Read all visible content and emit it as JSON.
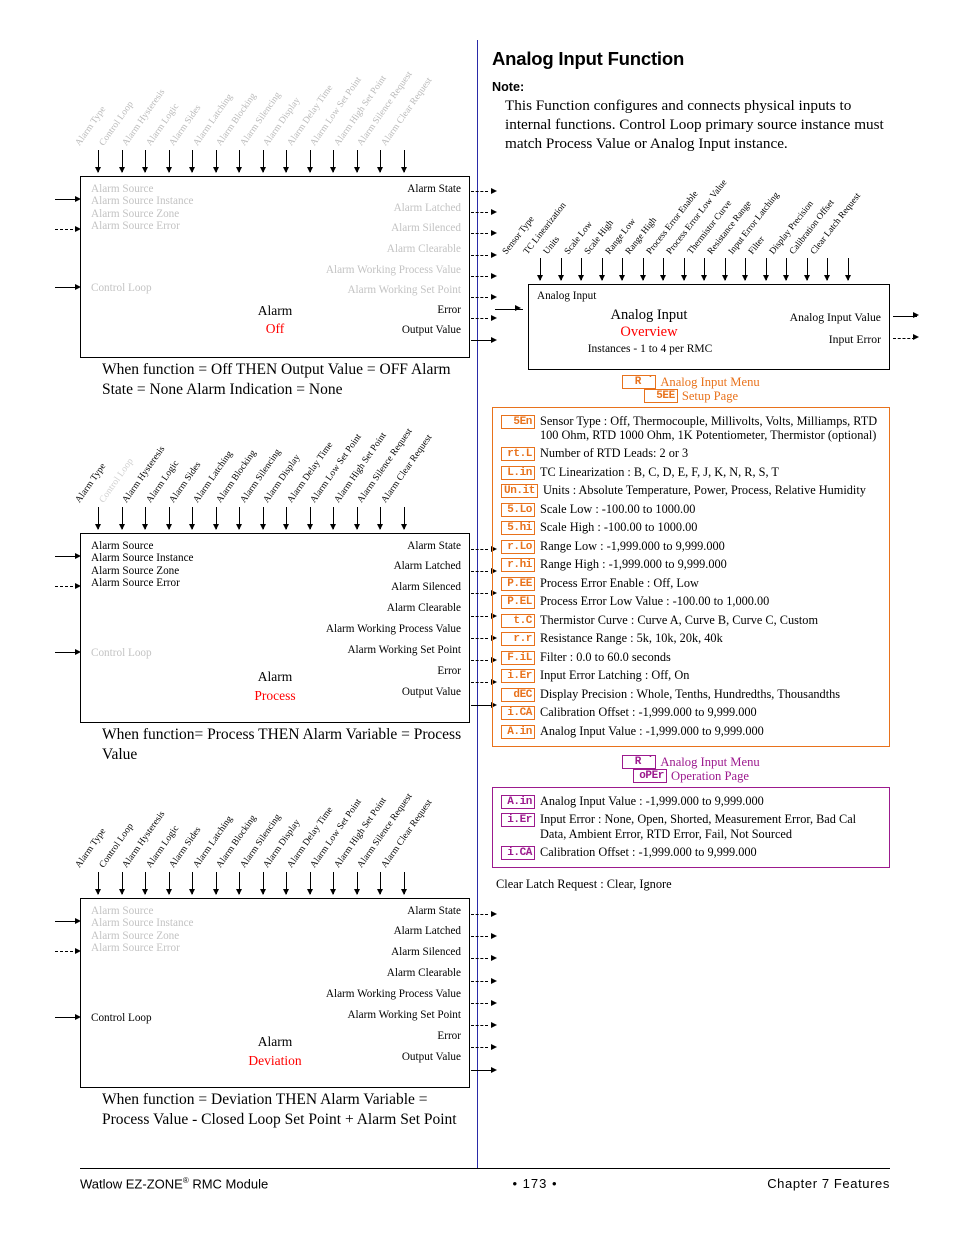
{
  "page": {
    "footer_left": "Watlow EZ-ZONE",
    "footer_left_sup": "®",
    "footer_left_tail": " RMC Module",
    "footer_page": "• 173 •",
    "footer_right": "Chapter 7 Features"
  },
  "alarm_inputs": [
    "Alarm Type",
    "Control Loop",
    "Alarm Hysteresis",
    "Alarm Logic",
    "Alarm Sides",
    "Alarm Latching",
    "Alarm Blocking",
    "Alarm Silencing",
    "Alarm Display",
    "Alarm Delay Time",
    "Alarm Low Set Point",
    "Alarm High Set Point",
    "Alarm Silence Request",
    "Alarm Clear Request"
  ],
  "alarm_block_inputs": [
    "Alarm Source",
    "Alarm Source Instance",
    "Alarm Source Zone",
    "Alarm Source Error"
  ],
  "alarm_control_loop": "Control Loop",
  "alarm_block_outputs": [
    "Alarm State",
    "Alarm Latched",
    "Alarm Silenced",
    "Alarm Clearable",
    "Alarm Working Process Value",
    "Alarm Working Set Point",
    "Error",
    "Output Value"
  ],
  "diagrams": [
    {
      "title": "Alarm",
      "subtitle": "Off",
      "caption": "When function = Off  THEN Output Value = OFF Alarm State = None Alarm Indication = None"
    },
    {
      "title": "Alarm",
      "subtitle": "Process",
      "caption": "When function= Process THEN Alarm Variable = Process Value"
    },
    {
      "title": "Alarm",
      "subtitle": "Deviation",
      "caption": "When function = Deviation THEN Alarm Variable = Process Value - Closed Loop Set Point + Alarm Set Point"
    }
  ],
  "analog": {
    "section_title": "Analog Input Function",
    "note_label": "Note:",
    "note_body": "This Function configures and connects physical inputs to internal functions. Control Loop primary source instance must match Process Value or Analog Input instance.",
    "inputs": [
      "Sensor Type",
      "TC Linearization",
      "Units",
      "Scale Low",
      "Scale High",
      "Range Low",
      "Range High",
      "Process Error Enable",
      "Process Error Low Value",
      "Thermistor Curve",
      "Resistance Range",
      "Input Error Latching",
      "Filter",
      "Display Precision",
      "Calibration Offset",
      "Clear Latch Request"
    ],
    "block_input": "Analog Input",
    "block_title": "Analog Input",
    "block_subtitle": "Overview",
    "block_instances": "Instances - 1 to 4 per RMC",
    "block_outputs": [
      "Analog Input Value",
      "Input Error"
    ],
    "setup_menu": {
      "seg_menu": "R ˙",
      "menu_label": "Analog Input Menu",
      "seg_page": "5EE",
      "page_label": "Setup Page"
    },
    "operation_menu": {
      "seg_menu": "R ˙",
      "menu_label": "Analog Input Menu",
      "seg_page": "oPEr",
      "page_label": "Operation Page"
    },
    "setup_params": [
      {
        "seg": "5En",
        "text": "Sensor Type : Off, Thermocouple, Millivolts, Volts, Milliamps, RTD 100 Ohm, RTD 1000 Ohm, 1K Potentiometer, Thermistor (optional)"
      },
      {
        "seg": "rt.L",
        "text": "Number of RTD Leads: 2 or 3"
      },
      {
        "seg": "L.in",
        "text": "TC Linearization : B, C, D, E, F, J, K, N, R, S, T"
      },
      {
        "seg": "Un.it",
        "text": "Units : Absolute Temperature, Power, Process, Relative Humidity"
      },
      {
        "seg": "5.Lo",
        "text": "Scale Low : -100.00 to 1000.00"
      },
      {
        "seg": "5.hi",
        "text": "Scale High : -100.00 to 1000.00"
      },
      {
        "seg": "r.Lo",
        "text": "Range Low : -1,999.000 to 9,999.000"
      },
      {
        "seg": "r.hi",
        "text": "Range High : -1,999.000 to 9,999.000"
      },
      {
        "seg": "P.EE",
        "text": "Process Error Enable : Off, Low"
      },
      {
        "seg": "P.EL",
        "text": "Process Error Low Value : -100.00 to 1,000.00"
      },
      {
        "seg": "t.C",
        "text": "Thermistor Curve : Curve A, Curve B, Curve C, Custom"
      },
      {
        "seg": "r.r",
        "text": "Resistance Range : 5k, 10k, 20k, 40k"
      },
      {
        "seg": "F.iL",
        "text": "Filter : 0.0 to 60.0 seconds"
      },
      {
        "seg": "i.Er",
        "text": "Input Error Latching : Off, On"
      },
      {
        "seg": "dEC",
        "text": "Display Precision :  Whole, Tenths, Hundredths, Thousandths"
      },
      {
        "seg": "i.CA",
        "text": "Calibration Offset : -1,999.000 to 9,999.000"
      },
      {
        "seg": "A.in",
        "text": "Analog Input Value :  -1,999.000 to 9,999.000"
      }
    ],
    "operation_params": [
      {
        "seg": "A.in",
        "text": "Analog Input Value :  -1,999.000 to 9,999.000"
      },
      {
        "seg": "i.Er",
        "text": "Input Error :  None, Open, Shorted, Measurement Error, Bad Cal Data, Ambient Error, RTD Error, Fail, Not Sourced"
      },
      {
        "seg": "i.CA",
        "text": "Calibration Offset : -1,999.000 to 9,999.000"
      }
    ],
    "clear_latch": "Clear Latch Request : Clear, Ignore"
  },
  "colors": {
    "orange": "#e8721c",
    "purple": "#9c1a8e",
    "red": "#ff0000",
    "divider_blue": "#2a2aa8"
  }
}
